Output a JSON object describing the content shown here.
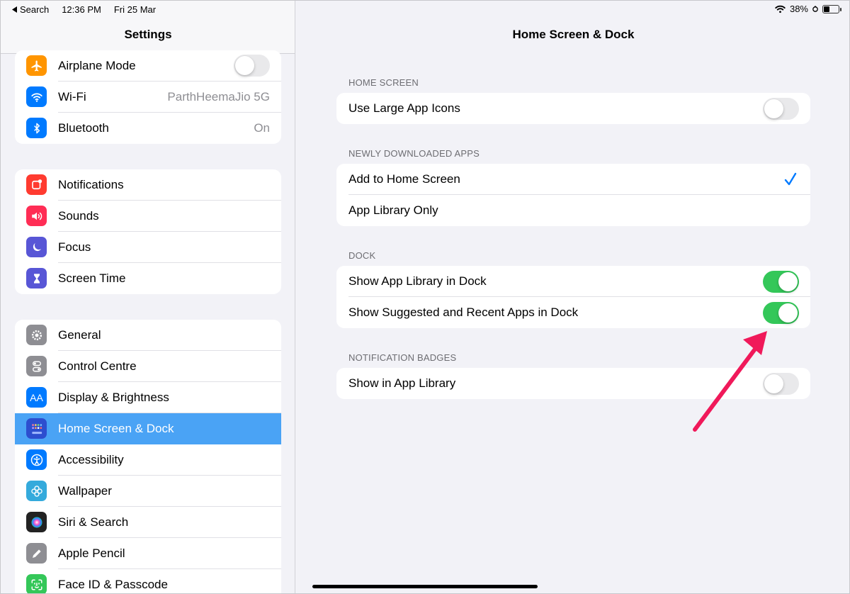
{
  "status_bar": {
    "back_label": "Search",
    "time": "12:36 PM",
    "date": "Fri 25 Mar",
    "battery": "38%",
    "battery_level": 0.38
  },
  "sidebar": {
    "title": "Settings",
    "groups": [
      {
        "items": [
          {
            "label": "Airplane Mode",
            "icon": "airplane-icon",
            "color": "#ff9500",
            "toggle": false
          },
          {
            "label": "Wi-Fi",
            "icon": "wifi-icon",
            "color": "#007aff",
            "value": "ParthHeemaJio 5G"
          },
          {
            "label": "Bluetooth",
            "icon": "bluetooth-icon",
            "color": "#007aff",
            "value": "On"
          }
        ]
      },
      {
        "items": [
          {
            "label": "Notifications",
            "icon": "notifications-icon",
            "color": "#ff3b30"
          },
          {
            "label": "Sounds",
            "icon": "sounds-icon",
            "color": "#ff2d55"
          },
          {
            "label": "Focus",
            "icon": "moon-icon",
            "color": "#5856d6"
          },
          {
            "label": "Screen Time",
            "icon": "hourglass-icon",
            "color": "#5856d6"
          }
        ]
      },
      {
        "items": [
          {
            "label": "General",
            "icon": "gear-icon",
            "color": "#8e8e93"
          },
          {
            "label": "Control Centre",
            "icon": "toggles-icon",
            "color": "#8e8e93"
          },
          {
            "label": "Display & Brightness",
            "icon": "display-icon",
            "color": "#007aff"
          },
          {
            "label": "Home Screen & Dock",
            "icon": "home-screen-icon",
            "color": "#2d4ecf",
            "selected": true
          },
          {
            "label": "Accessibility",
            "icon": "accessibility-icon",
            "color": "#007aff"
          },
          {
            "label": "Wallpaper",
            "icon": "wallpaper-icon",
            "color": "#34aadc"
          },
          {
            "label": "Siri & Search",
            "icon": "siri-icon",
            "color": "#222222"
          },
          {
            "label": "Apple Pencil",
            "icon": "pencil-icon",
            "color": "#8e8e93"
          },
          {
            "label": "Face ID & Passcode",
            "icon": "face-id-icon",
            "color": "#34c759"
          }
        ]
      }
    ]
  },
  "detail": {
    "title": "Home Screen & Dock",
    "sections": [
      {
        "header": "HOME SCREEN",
        "rows": [
          {
            "label": "Use Large App Icons",
            "toggle": false
          }
        ]
      },
      {
        "header": "NEWLY DOWNLOADED APPS",
        "rows": [
          {
            "label": "Add to Home Screen",
            "checked": true
          },
          {
            "label": "App Library Only",
            "checked": false
          }
        ]
      },
      {
        "header": "DOCK",
        "rows": [
          {
            "label": "Show App Library in Dock",
            "toggle": true
          },
          {
            "label": "Show Suggested and Recent Apps in Dock",
            "toggle": true
          }
        ]
      },
      {
        "header": "NOTIFICATION BADGES",
        "rows": [
          {
            "label": "Show in App Library",
            "toggle": false
          }
        ]
      }
    ]
  },
  "colors": {
    "accent": "#007aff",
    "toggle_on": "#34c759",
    "selection": "#4aa3f5",
    "annotation_arrow": "#f0195a"
  }
}
